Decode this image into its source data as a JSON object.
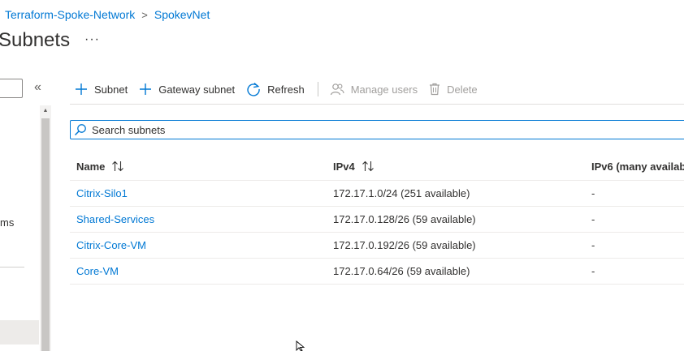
{
  "breadcrumb": {
    "items": [
      "Terraform-Spoke-Network",
      "SpokevNet"
    ],
    "separator": ">"
  },
  "page": {
    "title": "Subnets",
    "more_label": "···"
  },
  "left_nav": {
    "collapse_label": "«",
    "fragment_text": "ms"
  },
  "toolbar": {
    "add_subnet": "Subnet",
    "add_gateway_subnet": "Gateway subnet",
    "refresh": "Refresh",
    "manage_users": "Manage users",
    "delete": "Delete"
  },
  "search": {
    "placeholder": "Search subnets",
    "value": ""
  },
  "table": {
    "columns": [
      "Name",
      "IPv4",
      "IPv6 (many availabl"
    ],
    "rows": [
      {
        "name": "Citrix-Silo1",
        "ipv4": "172.17.1.0/24 (251 available)",
        "ipv6": "-"
      },
      {
        "name": "Shared-Services",
        "ipv4": "172.17.0.128/26 (59 available)",
        "ipv6": "-"
      },
      {
        "name": "Citrix-Core-VM",
        "ipv4": "172.17.0.192/26 (59 available)",
        "ipv6": "-"
      },
      {
        "name": "Core-VM",
        "ipv4": "172.17.0.64/26 (59 available)",
        "ipv6": "-"
      }
    ]
  },
  "colors": {
    "link": "#0078d4",
    "text": "#323130",
    "disabled": "#a19f9d",
    "border": "#e1dfdd"
  },
  "icons": {
    "add": "plus-icon",
    "refresh": "refresh-icon",
    "manage_users": "users-icon",
    "delete": "trash-icon",
    "search": "search-icon",
    "sort": "sort-icon"
  }
}
